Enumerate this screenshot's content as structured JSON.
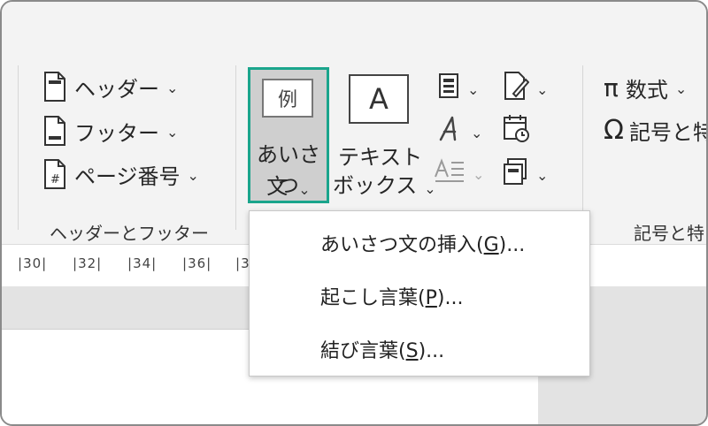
{
  "header_footer_group": {
    "header_label": "ヘッダー",
    "footer_label": "フッター",
    "page_number_label": "ページ番号",
    "group_label": "ヘッダーとフッター"
  },
  "text_group": {
    "aisatsu_icon_char": "例",
    "aisatsu_line1": "あいさつ",
    "aisatsu_line2": "文",
    "textbox_icon_char": "A",
    "textbox_line1": "テキスト",
    "textbox_line2": "ボックス"
  },
  "symbols_group": {
    "equation_label": "数式",
    "symbol_label": "記号と特",
    "group_label": "記号と特"
  },
  "ruler": {
    "ticks": [
      "30",
      "32",
      "34",
      "36",
      "3"
    ]
  },
  "dropdown_menu": {
    "items": [
      {
        "label": "あいさつ文の挿入(",
        "key": "G",
        "suffix": ")..."
      },
      {
        "label": "起こし言葉(",
        "key": "P",
        "suffix": ")..."
      },
      {
        "label": "結び言葉(",
        "key": "S",
        "suffix": ")..."
      }
    ]
  },
  "colors": {
    "highlight_border": "#1aa58c",
    "ribbon_bg": "#f3f3f3"
  }
}
